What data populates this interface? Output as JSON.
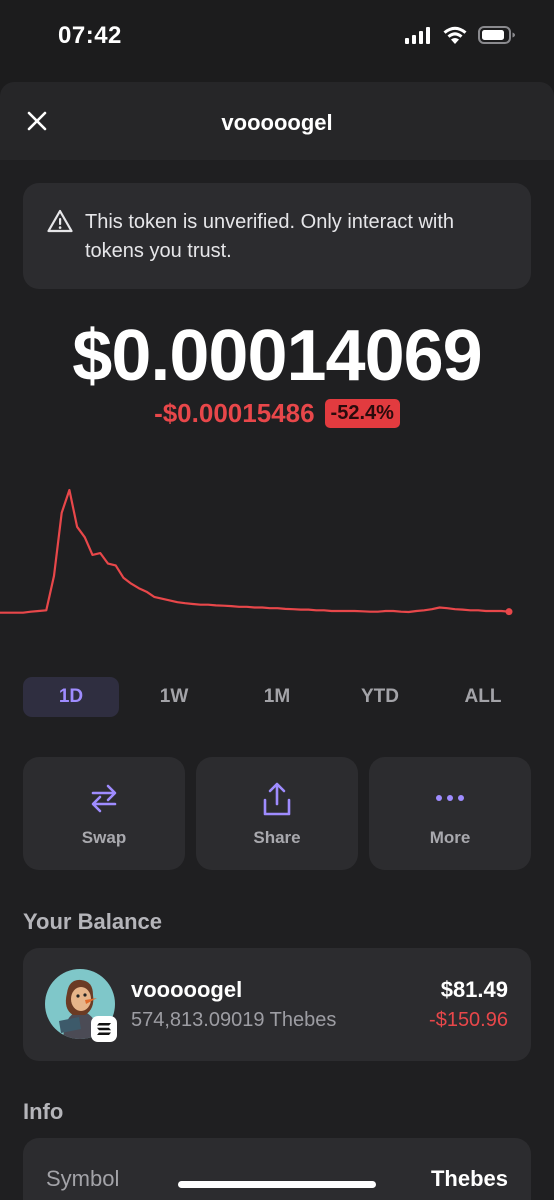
{
  "status_bar": {
    "time": "07:42"
  },
  "header": {
    "title": "vooooogel"
  },
  "warning": {
    "text": "This token is unverified. Only interact with tokens you trust."
  },
  "price": {
    "value": "$0.00014069",
    "change": "-$0.00015486",
    "change_percent": "-52.4%",
    "negative_color": "#e8474a"
  },
  "chart_data": {
    "type": "line",
    "color": "#e8474a",
    "values": [
      0.55,
      0.55,
      0.55,
      0.55,
      0.58,
      0.6,
      0.62,
      1.6,
      3.4,
      4.05,
      3.0,
      2.7,
      2.2,
      2.25,
      1.95,
      1.9,
      1.55,
      1.38,
      1.25,
      1.15,
      1.0,
      0.95,
      0.9,
      0.85,
      0.82,
      0.8,
      0.78,
      0.78,
      0.76,
      0.75,
      0.74,
      0.72,
      0.72,
      0.7,
      0.7,
      0.68,
      0.68,
      0.66,
      0.65,
      0.64,
      0.64,
      0.62,
      0.62,
      0.6,
      0.6,
      0.6,
      0.6,
      0.59,
      0.58,
      0.58,
      0.6,
      0.6,
      0.58,
      0.57,
      0.6,
      0.62,
      0.65,
      0.7,
      0.68,
      0.65,
      0.64,
      0.62,
      0.62,
      0.6,
      0.6,
      0.6,
      0.58
    ]
  },
  "time_ranges": [
    "1D",
    "1W",
    "1M",
    "YTD",
    "ALL"
  ],
  "active_range": "1D",
  "actions": {
    "swap": "Swap",
    "share": "Share",
    "more": "More"
  },
  "accent_color": "#9f8cff",
  "balance": {
    "section_title": "Your Balance",
    "token_name": "vooooogel",
    "amount": "574,813.09019 Thebes",
    "usd_value": "$81.49",
    "usd_change": "-$150.96"
  },
  "info": {
    "section_title": "Info",
    "symbol_label": "Symbol",
    "symbol_value": "Thebes"
  }
}
